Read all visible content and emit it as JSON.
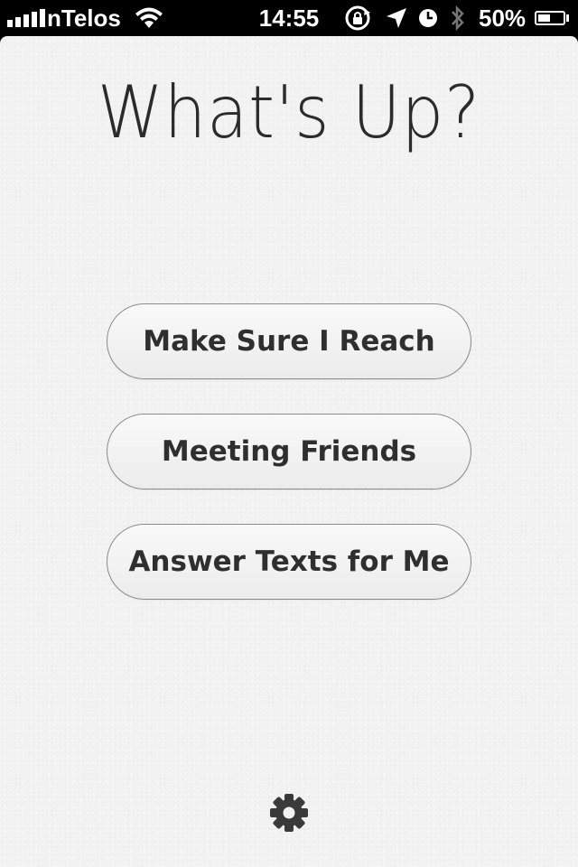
{
  "status_bar": {
    "carrier": "nTelos",
    "time": "14:55",
    "battery_percent": "50%",
    "battery_level": 0.5,
    "icons": [
      "signal-icon",
      "wifi-icon",
      "rotation-lock-icon",
      "location-arrow-icon",
      "alarm-icon",
      "bluetooth-icon",
      "battery-icon"
    ]
  },
  "app": {
    "title": "What's Up?",
    "buttons": [
      {
        "label": "Make Sure I Reach"
      },
      {
        "label": "Meeting Friends"
      },
      {
        "label": "Answer Texts for Me"
      }
    ],
    "settings_icon": "gear-icon"
  },
  "colors": {
    "background": "#f1f2f1",
    "text": "#2f2f2f",
    "button_border": "#8a8a8a"
  }
}
